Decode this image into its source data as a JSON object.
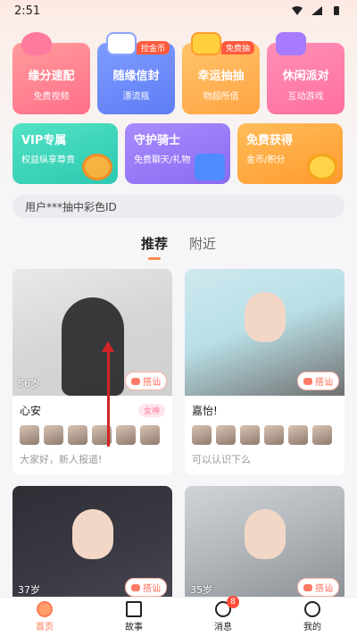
{
  "status_bar": {
    "time": "2:51"
  },
  "features": [
    {
      "title": "缘分速配",
      "sub": "免费视频",
      "badge": "",
      "icon": "heart-icon"
    },
    {
      "title": "随缘信封",
      "sub": "漂流瓶",
      "badge": "捡金币",
      "icon": "letter-icon"
    },
    {
      "title": "幸运抽抽",
      "sub": "物超所值",
      "badge": "免费抽",
      "icon": "gift-icon"
    },
    {
      "title": "休闲派对",
      "sub": "互动游戏",
      "badge": "",
      "icon": "gamepad-icon"
    }
  ],
  "secondary": [
    {
      "title": "VIP专属",
      "sub": "权益纵享尊贵",
      "icon": "cap-icon"
    },
    {
      "title": "守护骑士",
      "sub": "免费聊天/礼物",
      "icon": "gift-box-icon"
    },
    {
      "title": "免费获得",
      "sub": "金币/积分",
      "icon": "coin-icon"
    }
  ],
  "notice": {
    "text": "用户***抽中彩色ID"
  },
  "tabs": [
    {
      "label": "推荐",
      "active": true
    },
    {
      "label": "附近",
      "active": false
    }
  ],
  "users": [
    {
      "age": "56岁",
      "name": "心安",
      "tag": "女神",
      "desc": "大家好，新人报道!",
      "chat": "搭讪"
    },
    {
      "age": "",
      "name": "嘉怡!",
      "tag": "",
      "desc": "可以认识下么",
      "chat": "搭讪"
    },
    {
      "age": "37岁",
      "name": "",
      "tag": "",
      "desc": "",
      "chat": "搭讪"
    },
    {
      "age": "35岁",
      "name": "",
      "tag": "",
      "desc": "",
      "chat": "搭讪"
    }
  ],
  "nav": [
    {
      "label": "首页",
      "active": true,
      "badge": ""
    },
    {
      "label": "故事",
      "active": false,
      "badge": ""
    },
    {
      "label": "消息",
      "active": false,
      "badge": "8"
    },
    {
      "label": "我的",
      "active": false,
      "badge": ""
    }
  ],
  "colors": {
    "accent": "#ff7a55",
    "badge": "#ff4d3a"
  }
}
